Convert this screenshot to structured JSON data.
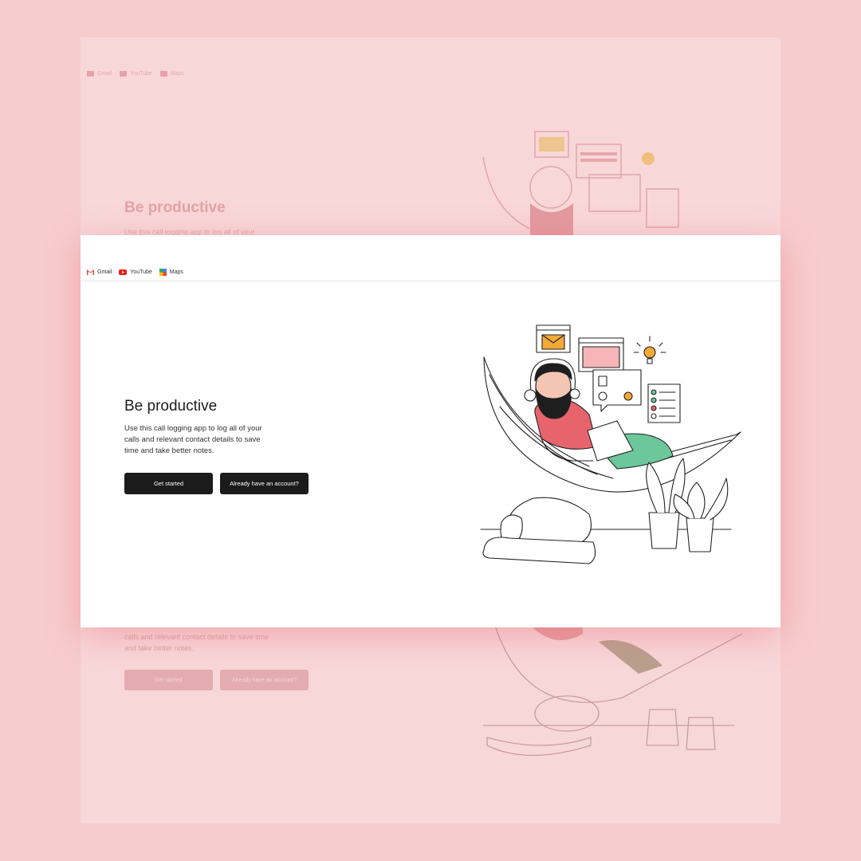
{
  "bookmarks": [
    {
      "label": "Gmail",
      "icon": "gmail-icon"
    },
    {
      "label": "YouTube",
      "icon": "youtube-icon"
    },
    {
      "label": "Maps",
      "icon": "maps-icon"
    }
  ],
  "hero": {
    "title": "Be productive",
    "description": "Use this call logging app to log all of your calls and relevant contact details to save time and take better notes.",
    "primary_button": "Get started",
    "secondary_button": "Already have an account?"
  },
  "ghost": {
    "title": "Be productive",
    "description_top": "Use this call logging app to log all of your",
    "description_bottom": "calls and relevant contact details to save time and take better notes.",
    "primary_button": "Get started",
    "secondary_button": "Already have an account?"
  },
  "colors": {
    "backdrop": "#f7cccd",
    "button_bg": "#1b1b1b",
    "accent_pink": "#e8646c",
    "accent_green": "#6cc79a",
    "accent_orange": "#f2a938"
  }
}
